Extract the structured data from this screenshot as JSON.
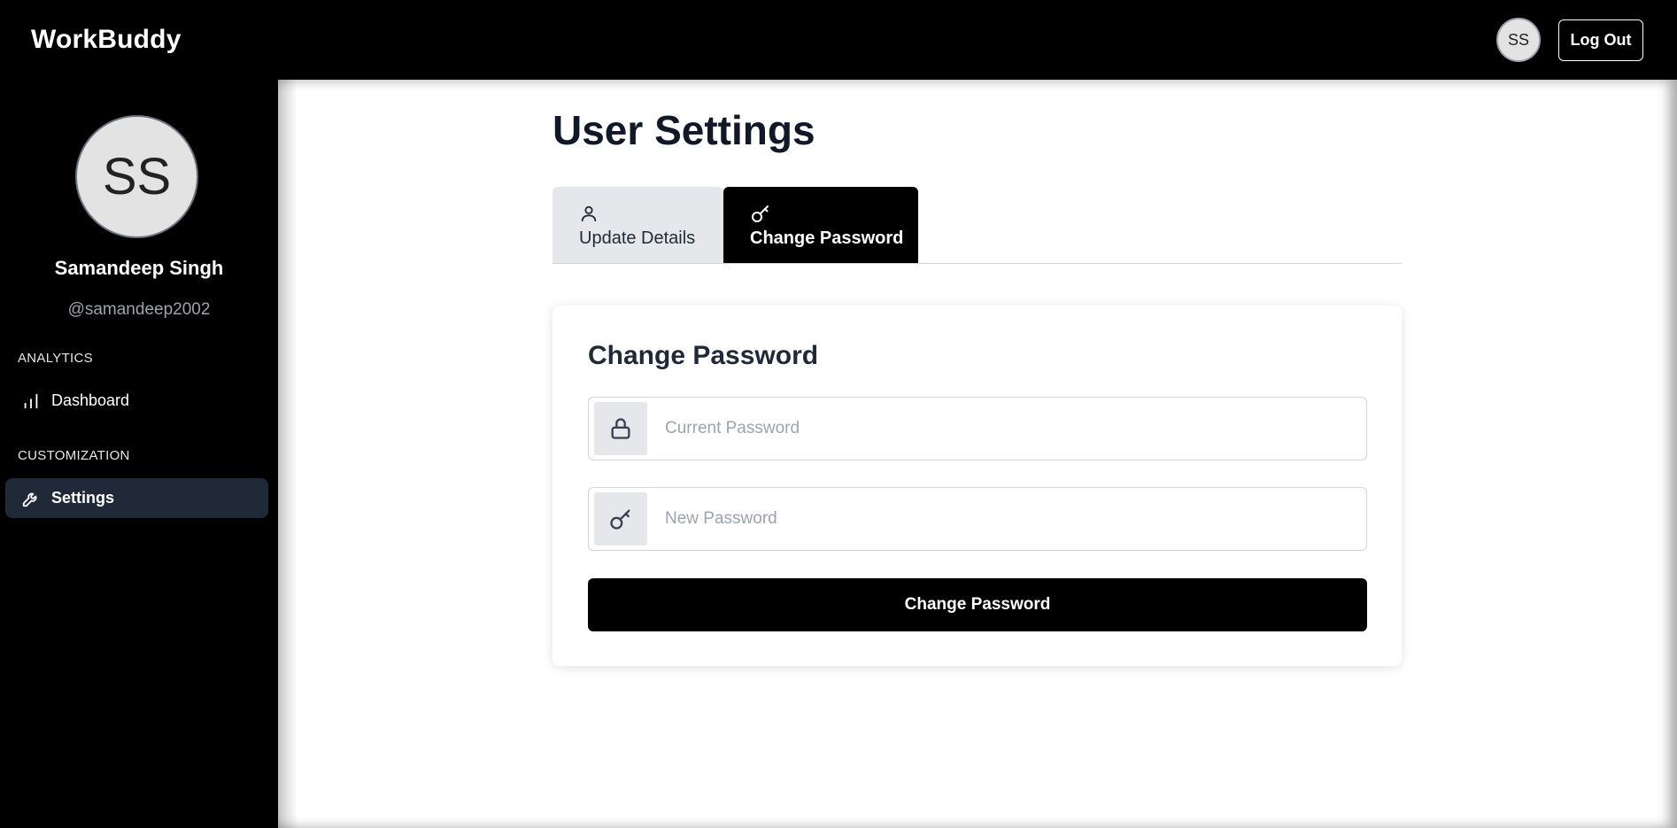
{
  "header": {
    "brand": "WorkBuddy",
    "avatar_initials": "SS",
    "logout_label": "Log Out"
  },
  "sidebar": {
    "avatar_initials": "SS",
    "user_name": "Samandeep Singh",
    "user_handle": "@samandeep2002",
    "sections": [
      {
        "label": "ANALYTICS",
        "items": [
          {
            "label": "Dashboard",
            "icon": "bar-chart-icon",
            "active": false
          }
        ]
      },
      {
        "label": "CUSTOMIZATION",
        "items": [
          {
            "label": "Settings",
            "icon": "wrench-icon",
            "active": true
          }
        ]
      }
    ]
  },
  "main": {
    "title": "User Settings",
    "tabs": [
      {
        "label": "Update Details",
        "icon": "user-icon",
        "active": false
      },
      {
        "label": "Change Password",
        "icon": "key-icon",
        "active": true
      }
    ],
    "card": {
      "title": "Change Password",
      "current_password": {
        "placeholder": "Current Password",
        "value": "",
        "icon": "lock-icon"
      },
      "new_password": {
        "placeholder": "New Password",
        "value": "",
        "icon": "key-icon"
      },
      "submit_label": "Change Password"
    }
  },
  "colors": {
    "background": "#000000",
    "active_nav": "#1f2937",
    "tab_inactive": "#e5e7eb",
    "accent_button": "#000000"
  }
}
